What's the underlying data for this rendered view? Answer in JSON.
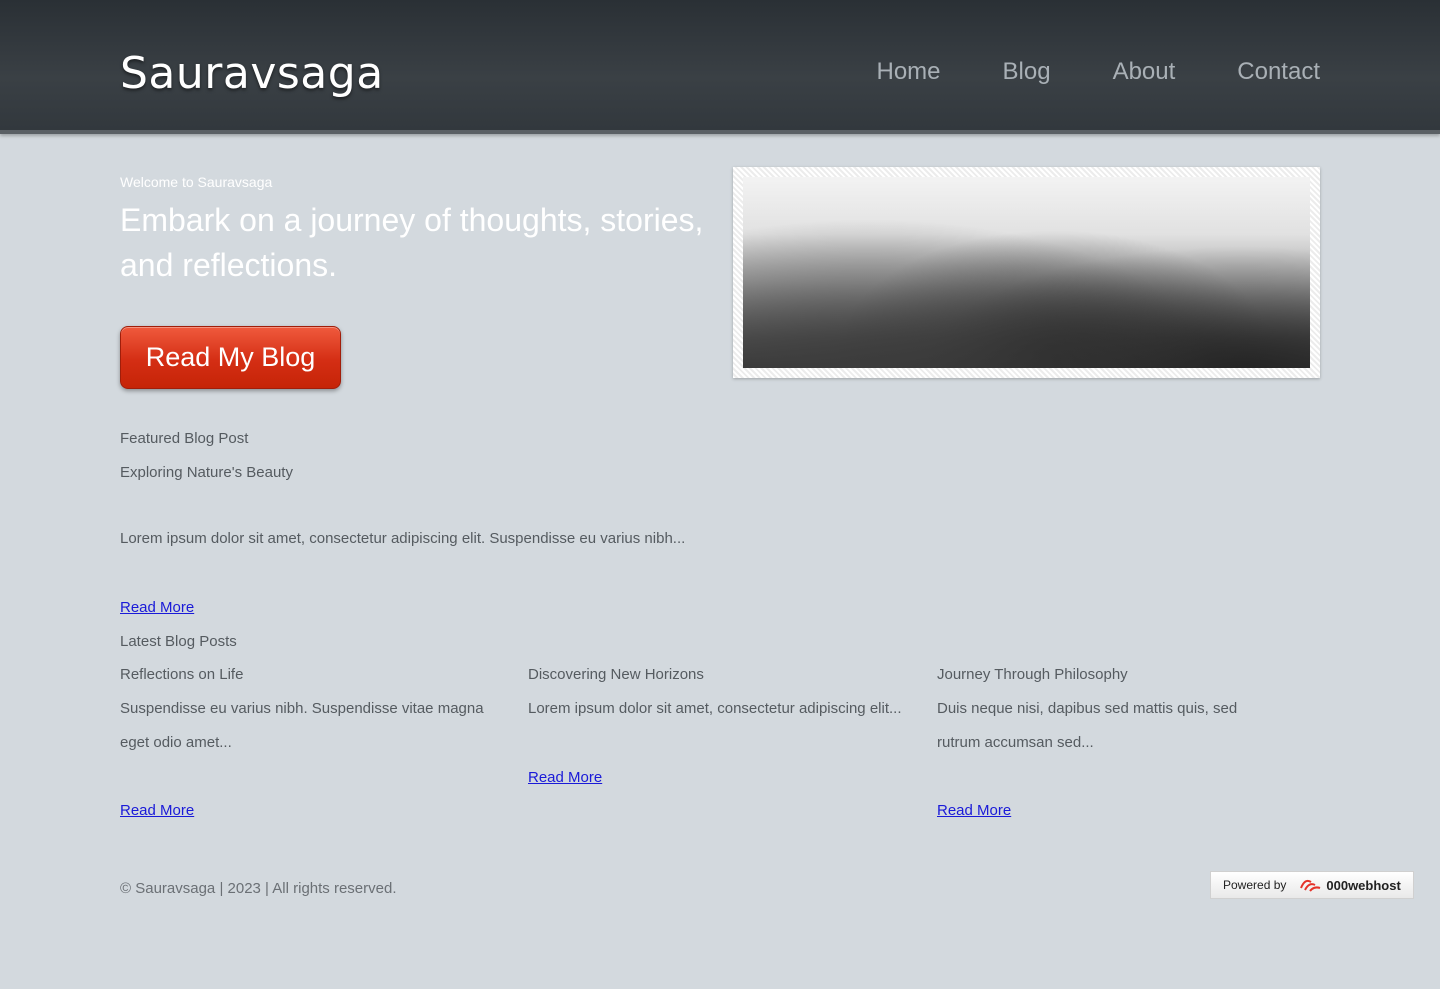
{
  "header": {
    "logo": "Sauravsaga",
    "nav": [
      "Home",
      "Blog",
      "About",
      "Contact"
    ]
  },
  "hero": {
    "welcome": "Welcome to Sauravsaga",
    "tagline": "Embark on a journey of thoughts, stories, and reflections.",
    "cta_label": "Read My Blog"
  },
  "featured": {
    "section_title": "Featured Blog Post",
    "post_title": "Exploring Nature's Beauty",
    "excerpt": "Lorem ipsum dolor sit amet, consectetur adipiscing elit. Suspendisse eu varius nibh...",
    "read_more": "Read More"
  },
  "latest": {
    "section_title": "Latest Blog Posts",
    "posts": [
      {
        "title": "Reflections on Life",
        "excerpt": "Suspendisse eu varius nibh. Suspendisse vitae magna eget odio amet...",
        "read_more": "Read More"
      },
      {
        "title": "Discovering New Horizons",
        "excerpt": "Lorem ipsum dolor sit amet, consectetur adipiscing elit...",
        "read_more": "Read More"
      },
      {
        "title": "Journey Through Philosophy",
        "excerpt": "Duis neque nisi, dapibus sed mattis quis, sed rutrum accumsan sed...",
        "read_more": "Read More"
      }
    ]
  },
  "footer": {
    "copyright": "© Sauravsaga | 2023 | All rights reserved.",
    "powered_by": "Powered by",
    "host": "000webhost"
  },
  "colors": {
    "header_bg": "#32383d",
    "page_bg": "#d3d9de",
    "cta": "#d42e14",
    "link": "#1a1ad8"
  }
}
